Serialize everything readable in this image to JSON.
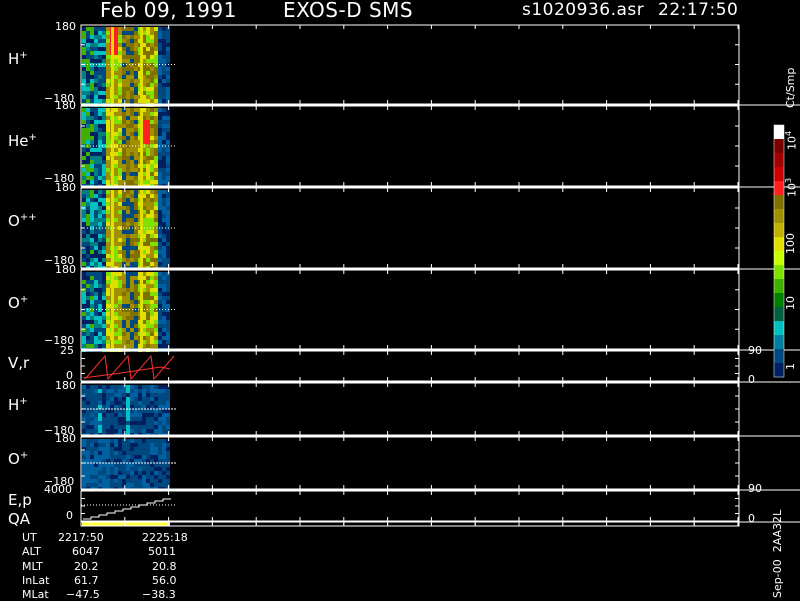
{
  "header": {
    "date": "Feb 09, 1991",
    "instrument": "EXOS-D SMS",
    "file": "s1020936.asr",
    "time": "22:17:50"
  },
  "colorbar": {
    "title": "Ct/Smp",
    "ticks": [
      "10",
      "10",
      "100",
      "10",
      "10",
      "1"
    ],
    "tick_sup": [
      "4",
      "",
      "",
      "3",
      "",
      ""
    ],
    "tick_values": [
      10000,
      1000,
      100,
      10,
      1
    ],
    "colors": [
      "#ffffff",
      "#7a0000",
      "#a00000",
      "#cc0000",
      "#ff2020",
      "#807000",
      "#a09000",
      "#c0b000",
      "#e0e000",
      "#c8ff00",
      "#80e000",
      "#40b000",
      "#008000",
      "#006040",
      "#00c0c0",
      "#0080a0",
      "#004880",
      "#002060"
    ]
  },
  "panels": [
    {
      "name": "H",
      "sup": "+",
      "ymax": "180",
      "ymin": "−180"
    },
    {
      "name": "He",
      "sup": "+",
      "ymax": "180",
      "ymin": "−180"
    },
    {
      "name": "O",
      "sup": "++",
      "ymax": "180",
      "ymin": "−180"
    },
    {
      "name": "O",
      "sup": "+",
      "ymax": "180",
      "ymin": "−180"
    },
    {
      "name": "V,r",
      "sup": "",
      "ymax": "25",
      "ymin": "0",
      "right_top": "90",
      "right_bottom": "0"
    },
    {
      "name": "H",
      "sup": "+",
      "ymax": "180",
      "ymin": "−180"
    },
    {
      "name": "O",
      "sup": "+",
      "ymax": "180",
      "ymin": "−180"
    },
    {
      "name": "E,p",
      "sup": "",
      "ymax": "4000",
      "ymin": "0",
      "right_top": "90",
      "right_bottom": "0"
    },
    {
      "name": "QA",
      "sup": "",
      "ymax": "",
      "ymin": ""
    }
  ],
  "ephemeris": {
    "rows": [
      {
        "label": "UT",
        "v1": "2217:50",
        "v2": "2225:18"
      },
      {
        "label": "ALT",
        "v1": "6047",
        "v2": "5011"
      },
      {
        "label": "MLT",
        "v1": "20.2",
        "v2": "20.8"
      },
      {
        "label": "InLat",
        "v1": "61.7",
        "v2": "56.0"
      },
      {
        "label": "MLat",
        "v1": "−47.5",
        "v2": "−38.3"
      }
    ]
  },
  "footer_vertical": "Sep-00  2AA32L",
  "chart_data": {
    "type": "heatmap",
    "title": "Feb 09, 1991   EXOS-D SMS",
    "xlabel": "UT",
    "time_range": [
      "2217:50",
      "2225:18"
    ],
    "panels": [
      {
        "species": "H+",
        "ylim": [
          -180,
          180
        ]
      },
      {
        "species": "He+",
        "ylim": [
          -180,
          180
        ]
      },
      {
        "species": "O++",
        "ylim": [
          -180,
          180
        ]
      },
      {
        "species": "O+",
        "ylim": [
          -180,
          180
        ]
      },
      {
        "species": "V,r",
        "ylim": [
          0,
          25
        ],
        "right_ylim": [
          0,
          90
        ]
      },
      {
        "species": "H+",
        "ylim": [
          -180,
          180
        ]
      },
      {
        "species": "O+",
        "ylim": [
          -180,
          180
        ]
      },
      {
        "species": "E,p",
        "ylim": [
          0,
          4000
        ],
        "right_ylim": [
          0,
          90
        ]
      },
      {
        "species": "QA"
      }
    ],
    "colorbar_label": "Ct/Smp",
    "colorbar_scale": "log",
    "colorbar_ticks": [
      1,
      10,
      100,
      1000,
      10000
    ]
  }
}
